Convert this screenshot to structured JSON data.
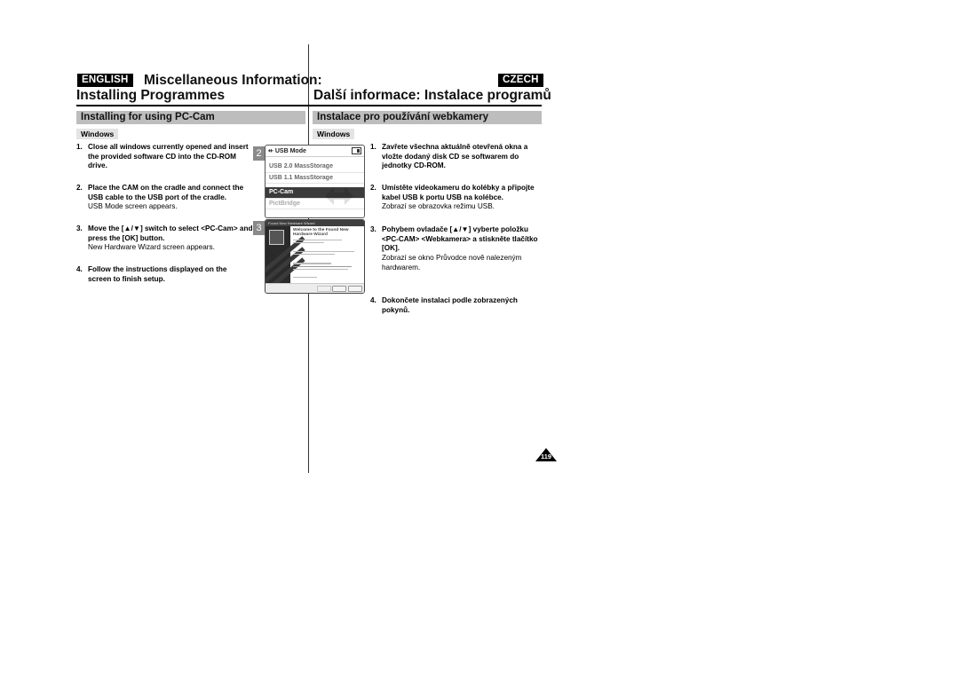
{
  "left": {
    "language": "ENGLISH",
    "title_line1": "Miscellaneous Information:",
    "title_line2": "Installing Programmes",
    "section": "Installing for using PC-Cam",
    "os_tag": "Windows",
    "steps": [
      {
        "num": "1.",
        "bold": "Close all windows currently opened and insert the provided software CD into the CD-ROM drive.",
        "note": ""
      },
      {
        "num": "2.",
        "bold": "Place the CAM on the cradle and connect the USB cable to the USB port of the cradle.",
        "note": "USB Mode screen appears."
      },
      {
        "num": "3.",
        "bold": "Move the [▲/▼] switch to select <PC-Cam> and press the [OK] button.",
        "note": "New Hardware Wizard screen appears."
      },
      {
        "num": "4.",
        "bold": "Follow the instructions displayed on the screen to finish setup.",
        "note": ""
      }
    ]
  },
  "right": {
    "language": "CZECH",
    "title": "Další informace: Instalace programů",
    "section": "Instalace pro používání webkamery",
    "os_tag": "Windows",
    "steps": [
      {
        "num": "1.",
        "bold": "Zavřete všechna aktuálně otevřená okna a vložte dodaný disk CD se softwarem do jednotky CD-ROM.",
        "note": ""
      },
      {
        "num": "2.",
        "bold": "Umístěte videokameru do kolébky a připojte kabel USB k portu USB na kolébce.",
        "note": "Zobrazí se obrazovka režimu USB."
      },
      {
        "num": "3.",
        "bold": "Pohybem ovladače [▲/▼] vyberte položku <PC-CAM> <Webkamera> a stiskněte tlačítko [OK].",
        "note": "Zobrazí se okno Průvodce nově nalezeným hardwarem."
      },
      {
        "num": "4.",
        "bold": "Dokončete instalaci podle zobrazených pokynů.",
        "note": ""
      }
    ]
  },
  "figures": {
    "usb_screen": {
      "number": "2",
      "header_icon": "usb-icon",
      "header": "USB Mode",
      "battery_icon": "battery-icon",
      "items": [
        "USB 2.0 MassStorage",
        "USB 1.1 MassStorage",
        "PC-Cam",
        "PictBridge"
      ],
      "selected": "PC-Cam"
    },
    "wizard_screen": {
      "number": "3",
      "title": "Found New Hardware Wizard",
      "heading": "Welcome to the Found New Hardware Wizard"
    }
  },
  "page_number": "119"
}
